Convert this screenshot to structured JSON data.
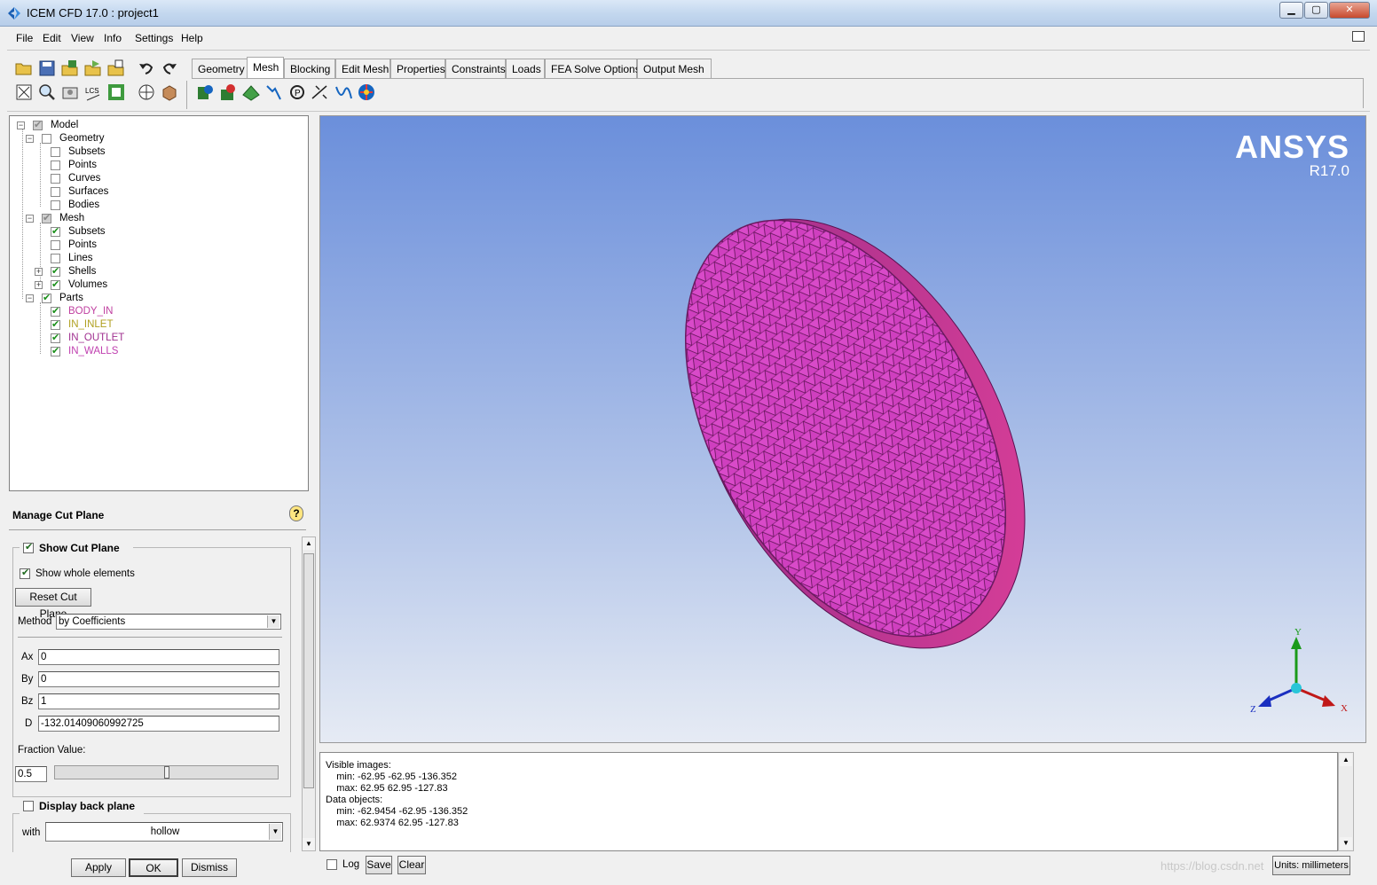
{
  "window": {
    "title": "ICEM CFD 17.0 : project1",
    "min": "0",
    "max": "1",
    "close": "r"
  },
  "menu": [
    "File",
    "Edit",
    "View",
    "Info",
    "Settings",
    "Help"
  ],
  "tabs": [
    {
      "label": "Geometry",
      "active": false
    },
    {
      "label": "Mesh",
      "active": true
    },
    {
      "label": "Blocking",
      "active": false
    },
    {
      "label": "Edit Mesh",
      "active": false
    },
    {
      "label": "Properties",
      "active": false
    },
    {
      "label": "Constraints",
      "active": false
    },
    {
      "label": "Loads",
      "active": false
    },
    {
      "label": "FEA Solve Options",
      "active": false
    },
    {
      "label": "Output Mesh",
      "active": false
    }
  ],
  "tree": {
    "model": "Model",
    "geometry": "Geometry",
    "geo_subsets": "Subsets",
    "geo_points": "Points",
    "geo_curves": "Curves",
    "geo_surfaces": "Surfaces",
    "geo_bodies": "Bodies",
    "mesh": "Mesh",
    "mesh_subsets": "Subsets",
    "mesh_points": "Points",
    "mesh_lines": "Lines",
    "mesh_shells": "Shells",
    "mesh_volumes": "Volumes",
    "parts": "Parts",
    "part_body_in": "BODY_IN",
    "part_in_inlet": "IN_INLET",
    "part_in_outlet": "IN_OUTLET",
    "part_in_walls": "IN_WALLS",
    "colors": {
      "body_in": "#c040a0",
      "in_inlet": "#b0a020",
      "in_outlet": "#a03090",
      "in_walls": "#c040b0"
    }
  },
  "cut_plane": {
    "title": "Manage Cut Plane",
    "help": "?",
    "show_cut_plane": "Show Cut Plane",
    "show_whole_elements": "Show whole elements",
    "reset": "Reset Cut Plane",
    "method_label": "Method",
    "method_value": "by Coefficients",
    "ax_label": "Ax",
    "ax_value": "0",
    "by_label": "By",
    "by_value": "0",
    "bz_label": "Bz",
    "bz_value": "1",
    "d_label": "D",
    "d_value": "-132.01409060992725",
    "fraction_label": "Fraction Value:",
    "fraction_value": "0.5",
    "fraction_level": 0.5,
    "display_back_plane": "Display back plane",
    "with_label": "with",
    "with_value": "hollow",
    "apply": "Apply",
    "ok": "OK",
    "dismiss": "Dismiss"
  },
  "viewport": {
    "brand": "ANSYS",
    "version": "R17.0",
    "axis_x": "X",
    "axis_y": "Y",
    "axis_z": "Z",
    "mesh_color": "#d040c0"
  },
  "messages": {
    "l1": "Visible images:",
    "l2": "    min: -62.95 -62.95 -136.352",
    "l3": "    max: 62.95 62.95 -127.83",
    "l4": "Data objects:",
    "l5": "    min: -62.9454 -62.95 -136.352",
    "l6": "    max: 62.9374 62.95 -127.83"
  },
  "bottom": {
    "log": "Log",
    "save": "Save",
    "clear": "Clear",
    "units": "Units: millimeters",
    "watermark": "https://blog.csdn.net"
  }
}
